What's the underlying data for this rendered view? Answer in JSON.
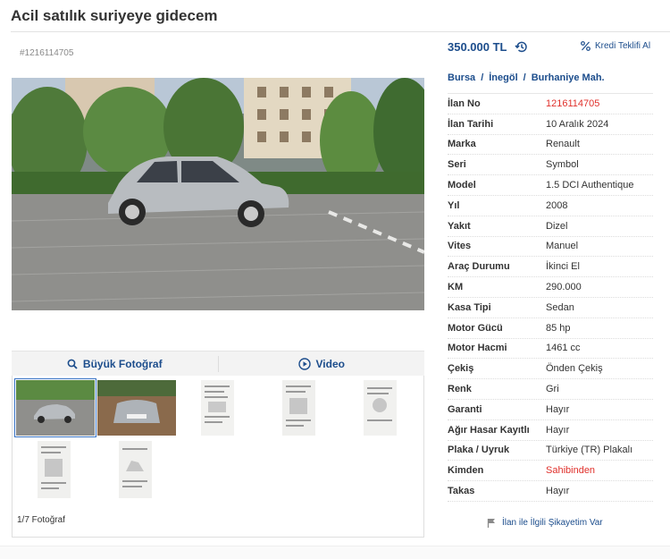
{
  "listing": {
    "title": "Acil satılık suriyeye gidecem",
    "ad_number_label": "#1216114705",
    "price": "350.000 TL",
    "credit_offer_label": "Kredi Teklifi Al"
  },
  "breadcrumb": [
    {
      "label": "Bursa"
    },
    {
      "label": "İnegöl"
    },
    {
      "label": "Burhaniye Mah."
    }
  ],
  "breadcrumb_sep": "/",
  "media": {
    "big_photo_label": "Büyük Fotoğraf",
    "video_label": "Video",
    "photo_count": "1/7 Fotoğraf"
  },
  "details": [
    {
      "key": "İlan No",
      "value": "1216114705",
      "highlight": true
    },
    {
      "key": "İlan Tarihi",
      "value": "10 Aralık 2024"
    },
    {
      "key": "Marka",
      "value": "Renault"
    },
    {
      "key": "Seri",
      "value": "Symbol"
    },
    {
      "key": "Model",
      "value": "1.5 DCI Authentique"
    },
    {
      "key": "Yıl",
      "value": "2008"
    },
    {
      "key": "Yakıt",
      "value": "Dizel"
    },
    {
      "key": "Vites",
      "value": "Manuel"
    },
    {
      "key": "Araç Durumu",
      "value": "İkinci El"
    },
    {
      "key": "KM",
      "value": "290.000"
    },
    {
      "key": "Kasa Tipi",
      "value": "Sedan"
    },
    {
      "key": "Motor Gücü",
      "value": "85 hp"
    },
    {
      "key": "Motor Hacmi",
      "value": "1461 cc"
    },
    {
      "key": "Çekiş",
      "value": "Önden Çekiş"
    },
    {
      "key": "Renk",
      "value": "Gri"
    },
    {
      "key": "Garanti",
      "value": "Hayır"
    },
    {
      "key": "Ağır Hasar Kayıtlı",
      "value": "Hayır"
    },
    {
      "key": "Plaka / Uyruk",
      "value": "Türkiye (TR) Plakalı"
    },
    {
      "key": "Kimden",
      "value": "Sahibinden",
      "highlight": true
    },
    {
      "key": "Takas",
      "value": "Hayır"
    }
  ],
  "complaint_label": "İlan ile İlgili Şikayetim Var",
  "colors": {
    "link_blue": "#1c4d8c",
    "highlight_red": "#e0302b"
  },
  "icons": {
    "price_history": "history-icon",
    "credit": "percent-icon",
    "big_photo": "search-icon",
    "video": "play-icon",
    "complaint": "flag-icon"
  }
}
